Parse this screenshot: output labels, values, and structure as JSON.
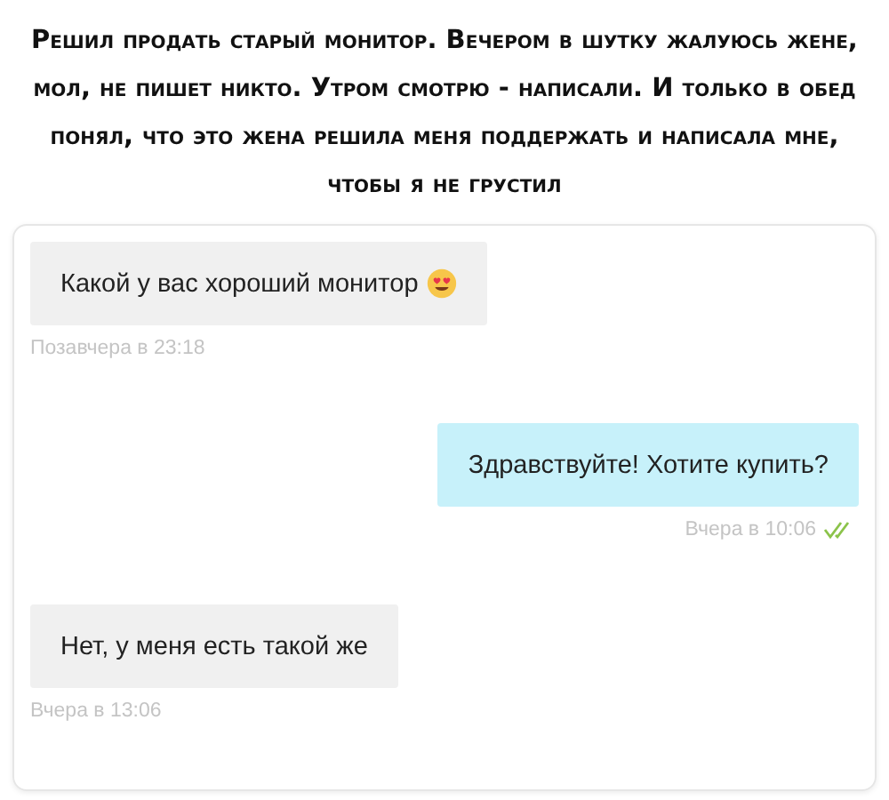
{
  "caption": "Решил продать старый монитор. Вечером в шутку жалуюсь жене, мол, не пишет никто. Утром смотрю - написали. И только в обед понял, что это жена решила меня поддержать и написала мне, чтобы я не грустил",
  "messages": [
    {
      "outgoing": false,
      "text": "Какой у вас хороший монитор",
      "has_emoji": true,
      "time": "Позавчера в 23:18"
    },
    {
      "outgoing": true,
      "text": "Здравствуйте! Хотите купить?",
      "read": true,
      "time": "Вчера в 10:06"
    },
    {
      "outgoing": false,
      "text": "Нет, у меня есть такой же",
      "time": "Вчера в 13:06"
    }
  ]
}
